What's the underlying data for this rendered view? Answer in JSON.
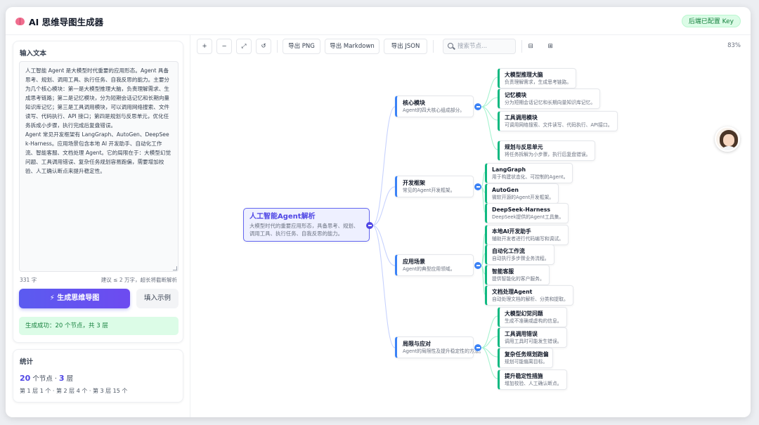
{
  "app": {
    "title": "AI 思维导图生成器",
    "key_badge": "后端已配置 Key"
  },
  "input": {
    "title": "输入文本",
    "text": "人工智能 Agent 是大模型时代重要的应用形态。Agent 具备思考、规划、调用工具、执行任务、自我反思的能力。主要分为几个核心模块：第一是大模型推理大脑，负责理解需求、生成思考链路；第二是记忆模块，分为短期会话记忆和长期向量知识库记忆；第三是工具调用模块，可以调用网络搜索、文件读写、代码执行、API 接口；第四是规划与反思单元，优化任务拆成小步骤，执行完成后复盘错误。\nAgent 常见开发框架有 LangGraph、AutoGen、DeepSeek-Harness。应用场景包含本地 AI 开发助手、自动化工作流、智能客服、文档处理 Agent。它的局限在于：大模型幻觉问题、工具调用错误、复杂任务规划容易跑偏，需要增加校验、人工确认断点来提升稳定性。",
    "char_count": "331 字",
    "limit_note": "建议 ≤ 2 万字，超长将截断解析",
    "generate_button": "⚡ 生成思维导图",
    "fill_example_button": "填入示例",
    "success_message": "生成成功：20 个节点，共 3 层"
  },
  "stats": {
    "title": "统计",
    "node_count": "20",
    "node_unit": " 个节点 · ",
    "layer_count": "3",
    "layer_unit": " 层",
    "breakdown": "第 1 层 1 个 · 第 2 层 4 个 · 第 3 层 15 个"
  },
  "toolbar": {
    "zoom_in": "+",
    "zoom_out": "−",
    "fit": "⤢",
    "reset": "↺",
    "export_png": "导出 PNG",
    "export_markdown": "导出 Markdown",
    "export_json": "导出 JSON",
    "search_placeholder": "搜索节点...",
    "layout_btn_1": "⊟",
    "layout_btn_2": "⊞",
    "zoom_level": "83%"
  },
  "mindmap": {
    "root": {
      "title": "人工智能Agent解析",
      "desc": "大模型时代的重要应用形态，具备思考、规划、调用工具、执行任务、自我反思的能力。"
    },
    "branches": [
      {
        "title": "核心模块",
        "desc": "Agent的四大核心组成部分。",
        "children": [
          {
            "title": "大模型推理大脑",
            "desc": "负责理解需求，生成思考链路。"
          },
          {
            "title": "记忆模块",
            "desc": "分为短期会话记忆和长期向量知识库记忆。"
          },
          {
            "title": "工具调用模块",
            "desc": "可调用网络搜索、文件读写、代码执行、API接口。"
          },
          {
            "title": "规划与反思单元",
            "desc": "将任务拆解为小步骤，执行后复盘错误。"
          }
        ]
      },
      {
        "title": "开发框架",
        "desc": "常见的Agent开发框架。",
        "children": [
          {
            "title": "LangGraph",
            "desc": "用于构建状态化、可控制的Agent。"
          },
          {
            "title": "AutoGen",
            "desc": "微软开源的Agent开发框架。"
          },
          {
            "title": "DeepSeek-Harness",
            "desc": "DeepSeek提供的Agent工具集。"
          }
        ]
      },
      {
        "title": "应用场景",
        "desc": "Agent的典型应用领域。",
        "children": [
          {
            "title": "本地AI开发助手",
            "desc": "辅助开发者进行代码编写和调试。"
          },
          {
            "title": "自动化工作流",
            "desc": "自动执行多步骤业务流程。"
          },
          {
            "title": "智能客服",
            "desc": "提供智能化的客户服务。"
          },
          {
            "title": "文档处理Agent",
            "desc": "自动处理文档的解析、分类和提取。"
          }
        ]
      },
      {
        "title": "局限与应对",
        "desc": "Agent的局限性及提升稳定性的方法。",
        "children": [
          {
            "title": "大模型幻觉问题",
            "desc": "生成不准确或虚构的信息。"
          },
          {
            "title": "工具调用错误",
            "desc": "调用工具时可能发生错误。"
          },
          {
            "title": "复杂任务规划跑偏",
            "desc": "规划可能偏离目标。"
          },
          {
            "title": "提升稳定性措施",
            "desc": "增加校验、人工确认断点。"
          }
        ]
      }
    ]
  }
}
